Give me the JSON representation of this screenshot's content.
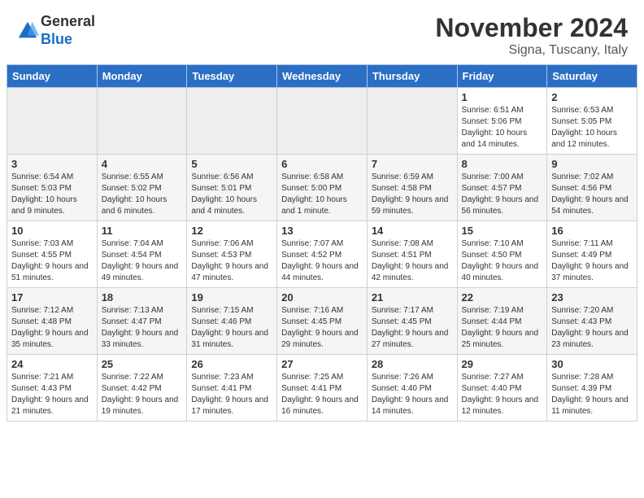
{
  "header": {
    "logo_general": "General",
    "logo_blue": "Blue",
    "title": "November 2024",
    "subtitle": "Signa, Tuscany, Italy"
  },
  "weekdays": [
    "Sunday",
    "Monday",
    "Tuesday",
    "Wednesday",
    "Thursday",
    "Friday",
    "Saturday"
  ],
  "weeks": [
    [
      {
        "day": "",
        "info": ""
      },
      {
        "day": "",
        "info": ""
      },
      {
        "day": "",
        "info": ""
      },
      {
        "day": "",
        "info": ""
      },
      {
        "day": "",
        "info": ""
      },
      {
        "day": "1",
        "info": "Sunrise: 6:51 AM\nSunset: 5:06 PM\nDaylight: 10 hours and 14 minutes."
      },
      {
        "day": "2",
        "info": "Sunrise: 6:53 AM\nSunset: 5:05 PM\nDaylight: 10 hours and 12 minutes."
      }
    ],
    [
      {
        "day": "3",
        "info": "Sunrise: 6:54 AM\nSunset: 5:03 PM\nDaylight: 10 hours and 9 minutes."
      },
      {
        "day": "4",
        "info": "Sunrise: 6:55 AM\nSunset: 5:02 PM\nDaylight: 10 hours and 6 minutes."
      },
      {
        "day": "5",
        "info": "Sunrise: 6:56 AM\nSunset: 5:01 PM\nDaylight: 10 hours and 4 minutes."
      },
      {
        "day": "6",
        "info": "Sunrise: 6:58 AM\nSunset: 5:00 PM\nDaylight: 10 hours and 1 minute."
      },
      {
        "day": "7",
        "info": "Sunrise: 6:59 AM\nSunset: 4:58 PM\nDaylight: 9 hours and 59 minutes."
      },
      {
        "day": "8",
        "info": "Sunrise: 7:00 AM\nSunset: 4:57 PM\nDaylight: 9 hours and 56 minutes."
      },
      {
        "day": "9",
        "info": "Sunrise: 7:02 AM\nSunset: 4:56 PM\nDaylight: 9 hours and 54 minutes."
      }
    ],
    [
      {
        "day": "10",
        "info": "Sunrise: 7:03 AM\nSunset: 4:55 PM\nDaylight: 9 hours and 51 minutes."
      },
      {
        "day": "11",
        "info": "Sunrise: 7:04 AM\nSunset: 4:54 PM\nDaylight: 9 hours and 49 minutes."
      },
      {
        "day": "12",
        "info": "Sunrise: 7:06 AM\nSunset: 4:53 PM\nDaylight: 9 hours and 47 minutes."
      },
      {
        "day": "13",
        "info": "Sunrise: 7:07 AM\nSunset: 4:52 PM\nDaylight: 9 hours and 44 minutes."
      },
      {
        "day": "14",
        "info": "Sunrise: 7:08 AM\nSunset: 4:51 PM\nDaylight: 9 hours and 42 minutes."
      },
      {
        "day": "15",
        "info": "Sunrise: 7:10 AM\nSunset: 4:50 PM\nDaylight: 9 hours and 40 minutes."
      },
      {
        "day": "16",
        "info": "Sunrise: 7:11 AM\nSunset: 4:49 PM\nDaylight: 9 hours and 37 minutes."
      }
    ],
    [
      {
        "day": "17",
        "info": "Sunrise: 7:12 AM\nSunset: 4:48 PM\nDaylight: 9 hours and 35 minutes."
      },
      {
        "day": "18",
        "info": "Sunrise: 7:13 AM\nSunset: 4:47 PM\nDaylight: 9 hours and 33 minutes."
      },
      {
        "day": "19",
        "info": "Sunrise: 7:15 AM\nSunset: 4:46 PM\nDaylight: 9 hours and 31 minutes."
      },
      {
        "day": "20",
        "info": "Sunrise: 7:16 AM\nSunset: 4:45 PM\nDaylight: 9 hours and 29 minutes."
      },
      {
        "day": "21",
        "info": "Sunrise: 7:17 AM\nSunset: 4:45 PM\nDaylight: 9 hours and 27 minutes."
      },
      {
        "day": "22",
        "info": "Sunrise: 7:19 AM\nSunset: 4:44 PM\nDaylight: 9 hours and 25 minutes."
      },
      {
        "day": "23",
        "info": "Sunrise: 7:20 AM\nSunset: 4:43 PM\nDaylight: 9 hours and 23 minutes."
      }
    ],
    [
      {
        "day": "24",
        "info": "Sunrise: 7:21 AM\nSunset: 4:43 PM\nDaylight: 9 hours and 21 minutes."
      },
      {
        "day": "25",
        "info": "Sunrise: 7:22 AM\nSunset: 4:42 PM\nDaylight: 9 hours and 19 minutes."
      },
      {
        "day": "26",
        "info": "Sunrise: 7:23 AM\nSunset: 4:41 PM\nDaylight: 9 hours and 17 minutes."
      },
      {
        "day": "27",
        "info": "Sunrise: 7:25 AM\nSunset: 4:41 PM\nDaylight: 9 hours and 16 minutes."
      },
      {
        "day": "28",
        "info": "Sunrise: 7:26 AM\nSunset: 4:40 PM\nDaylight: 9 hours and 14 minutes."
      },
      {
        "day": "29",
        "info": "Sunrise: 7:27 AM\nSunset: 4:40 PM\nDaylight: 9 hours and 12 minutes."
      },
      {
        "day": "30",
        "info": "Sunrise: 7:28 AM\nSunset: 4:39 PM\nDaylight: 9 hours and 11 minutes."
      }
    ]
  ]
}
